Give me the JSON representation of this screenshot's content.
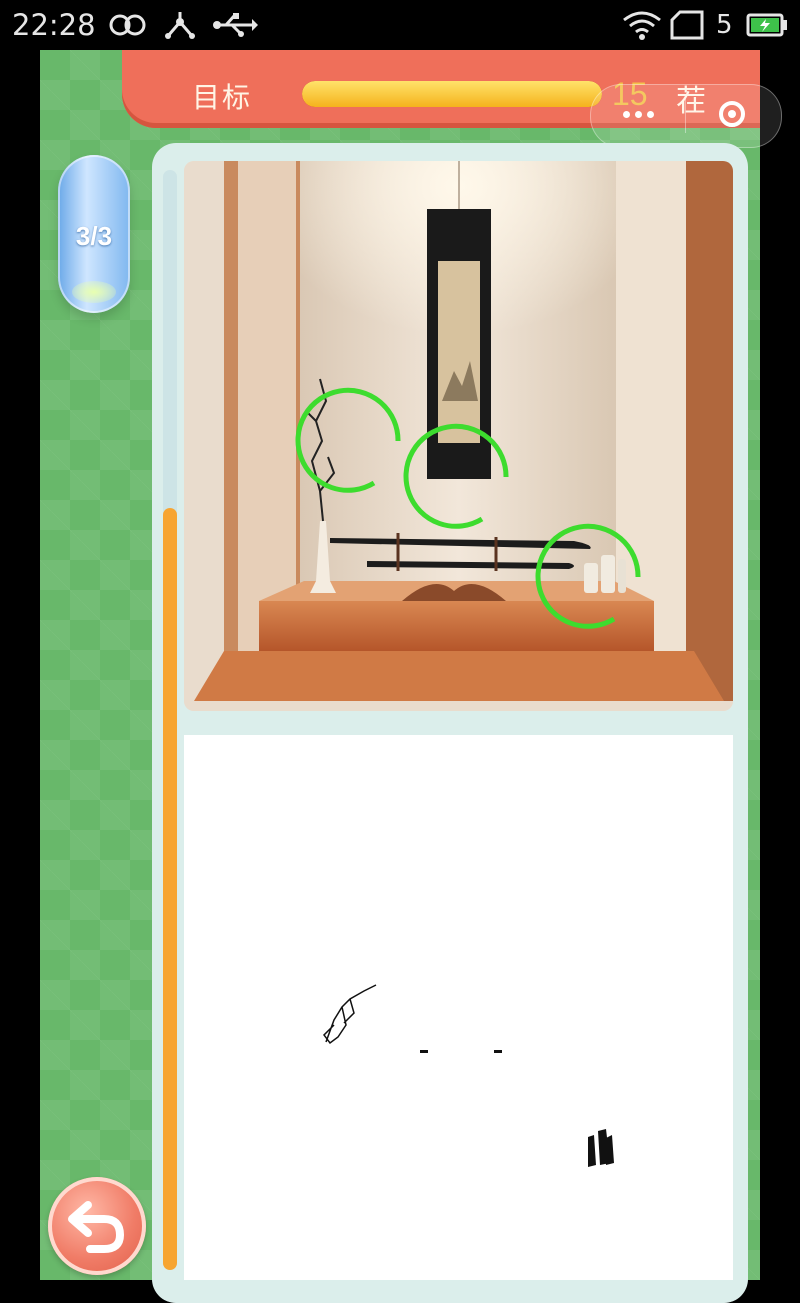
{
  "status_bar": {
    "time": "22:28",
    "icons": [
      "infinity-icon",
      "share-hub-icon",
      "usb-icon",
      "wifi-icon",
      "sim-card-icon",
      "battery-charging-icon"
    ],
    "sim_number": "5"
  },
  "header": {
    "goal_label": "目标",
    "goal_progress": 1.0,
    "goal_count": "15",
    "goal_char": "茬"
  },
  "capsule": {
    "icons": [
      "more-dots-icon",
      "target-close-icon"
    ]
  },
  "level": {
    "text": "3/3"
  },
  "scene": {
    "description_icons": [
      "branch-vase",
      "hanging-scroll",
      "katana-stand",
      "candles"
    ],
    "found_markers": 3
  },
  "colors": {
    "frame_green": "#68b86a",
    "header_red": "#ef6f5a",
    "progress_yellow": "#f5b21c",
    "marker_green": "#3ddc2e",
    "scroll_orange": "#f7a531"
  }
}
